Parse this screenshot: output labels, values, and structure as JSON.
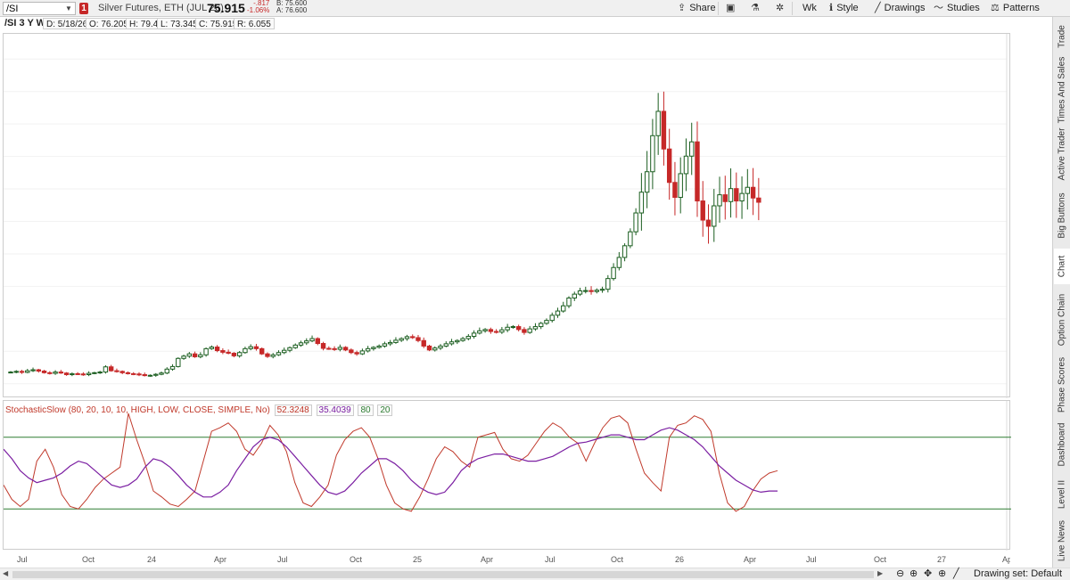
{
  "toolbar": {
    "symbol": "/SI",
    "alert_count": "1",
    "description": "Silver Futures, ETH (JUL 26)",
    "last_price": "75.915",
    "net_change": "-.817",
    "pct_change": "-1.06%",
    "bid": "B: 75.600",
    "ask": "A: 76.600",
    "share_label": "Share",
    "timeframe_label": "Wk",
    "style_label": "Style",
    "drawings_label": "Drawings",
    "studies_label": "Studies",
    "patterns_label": "Patterns"
  },
  "infobar": {
    "title": "/SI 3 Y W",
    "date": "D: 5/18/26",
    "open": "O: 76.205",
    "high": "H: 79.4",
    "low": "L: 73.345",
    "close": "C: 75.915",
    "range": "R: 6.055"
  },
  "stochastic": {
    "label": "StochasticSlow (80, 20, 10, 10, HIGH, LOW, CLOSE, SIMPLE, No)",
    "slowk": "52.3248",
    "slowd": "35.4039",
    "overbought": "80",
    "oversold": "20",
    "colors": {
      "slowk": "#c0392b",
      "slowd": "#7b1fa2",
      "level": "#2e7d32"
    }
  },
  "colors": {
    "up": "#1b5e20",
    "down": "#c62828",
    "grid": "#e8e8e8"
  },
  "bottom": {
    "drawing_set": "Drawing set: Default"
  },
  "sidebar_tabs": [
    "Trade",
    "Times And Sales",
    "Active Trader",
    "Big Buttons",
    "Chart",
    "Option Chain",
    "Phase Scores",
    "Dashboard",
    "Level II",
    "Live News"
  ],
  "chart_data": [
    {
      "type": "candlestick",
      "title": "/SI 3 Y W",
      "y_ticks": [
        "20",
        "30",
        "40",
        "50",
        "60",
        "70",
        "80",
        "90",
        "100",
        "110",
        "120"
      ],
      "x_ticks": [
        "Jul",
        "Oct",
        "24",
        "Apr",
        "Jul",
        "Oct",
        "25",
        "Apr",
        "Jul",
        "Oct",
        "26",
        "Apr",
        "Jul",
        "Oct",
        "27",
        "Apr"
      ],
      "ylim": [
        15,
        125
      ],
      "approx_weekly_close": [
        23.6,
        23.8,
        23.5,
        24.0,
        24.3,
        23.9,
        23.4,
        23.2,
        23.6,
        23.3,
        22.8,
        23.1,
        23.0,
        22.8,
        23.2,
        23.4,
        23.6,
        25.2,
        24.0,
        23.8,
        23.4,
        23.1,
        23.0,
        22.8,
        22.5,
        22.6,
        22.9,
        23.3,
        24.5,
        25.3,
        27.8,
        28.5,
        29.2,
        28.3,
        28.9,
        30.8,
        31.3,
        30.2,
        29.7,
        29.4,
        28.6,
        29.6,
        30.8,
        31.4,
        30.8,
        29.2,
        28.4,
        28.9,
        29.6,
        30.3,
        31.1,
        31.9,
        32.6,
        33.2,
        33.9,
        32.4,
        30.9,
        30.8,
        30.6,
        31.2,
        30.4,
        29.6,
        29.2,
        30.1,
        30.8,
        31.2,
        31.6,
        32.3,
        32.7,
        33.4,
        33.9,
        34.5,
        34.2,
        33.3,
        31.6,
        30.4,
        31.0,
        31.6,
        32.3,
        32.9,
        33.3,
        33.9,
        34.6,
        35.6,
        36.3,
        36.7,
        36.1,
        35.9,
        36.6,
        37.4,
        37.6,
        36.7,
        35.8,
        36.9,
        37.6,
        38.6,
        39.5,
        41.1,
        42.4,
        44.0,
        46.4,
        47.6,
        48.6,
        48.7,
        48.4,
        48.8,
        49.1,
        52.4,
        55.8,
        58.9,
        62.5,
        66.8,
        72.6,
        79.0,
        85.3,
        96.4,
        103.9,
        92.3,
        82.0,
        77.4,
        84.7,
        90.1,
        94.5,
        76.3,
        70.4,
        68.5,
        74.8,
        78.2,
        76.1,
        80.1,
        76.3,
        78.6,
        80.5,
        77.2,
        75.9
      ],
      "stochastic_slowk_approx": [
        40,
        28,
        22,
        28,
        60,
        70,
        55,
        32,
        22,
        20,
        28,
        38,
        45,
        50,
        55,
        100,
        78,
        58,
        35,
        30,
        24,
        22,
        28,
        35,
        60,
        85,
        88,
        92,
        85,
        70,
        65,
        75,
        90,
        82,
        68,
        42,
        25,
        22,
        30,
        40,
        65,
        78,
        85,
        88,
        80,
        62,
        40,
        25,
        20,
        18,
        30,
        45,
        62,
        72,
        68,
        60,
        55,
        80,
        82,
        84,
        70,
        62,
        60,
        65,
        75,
        85,
        92,
        88,
        80,
        75,
        60,
        75,
        88,
        96,
        98,
        92,
        70,
        50,
        42,
        35,
        80,
        90,
        92,
        98,
        95,
        85,
        50,
        25,
        18,
        22,
        35,
        45,
        50,
        52
      ],
      "stochastic_slowd_approx": [
        70,
        62,
        52,
        46,
        42,
        44,
        46,
        50,
        56,
        60,
        58,
        52,
        46,
        40,
        38,
        40,
        45,
        55,
        62,
        60,
        55,
        48,
        40,
        34,
        30,
        30,
        34,
        40,
        52,
        62,
        72,
        78,
        80,
        78,
        72,
        64,
        56,
        48,
        40,
        34,
        32,
        35,
        42,
        50,
        56,
        62,
        62,
        58,
        52,
        44,
        38,
        34,
        32,
        34,
        42,
        52,
        58,
        62,
        64,
        66,
        66,
        64,
        62,
        60,
        60,
        62,
        64,
        68,
        72,
        75,
        76,
        78,
        80,
        82,
        82,
        80,
        78,
        78,
        82,
        86,
        88,
        86,
        82,
        78,
        72,
        64,
        56,
        50,
        44,
        40,
        36,
        34,
        35,
        35
      ]
    }
  ]
}
